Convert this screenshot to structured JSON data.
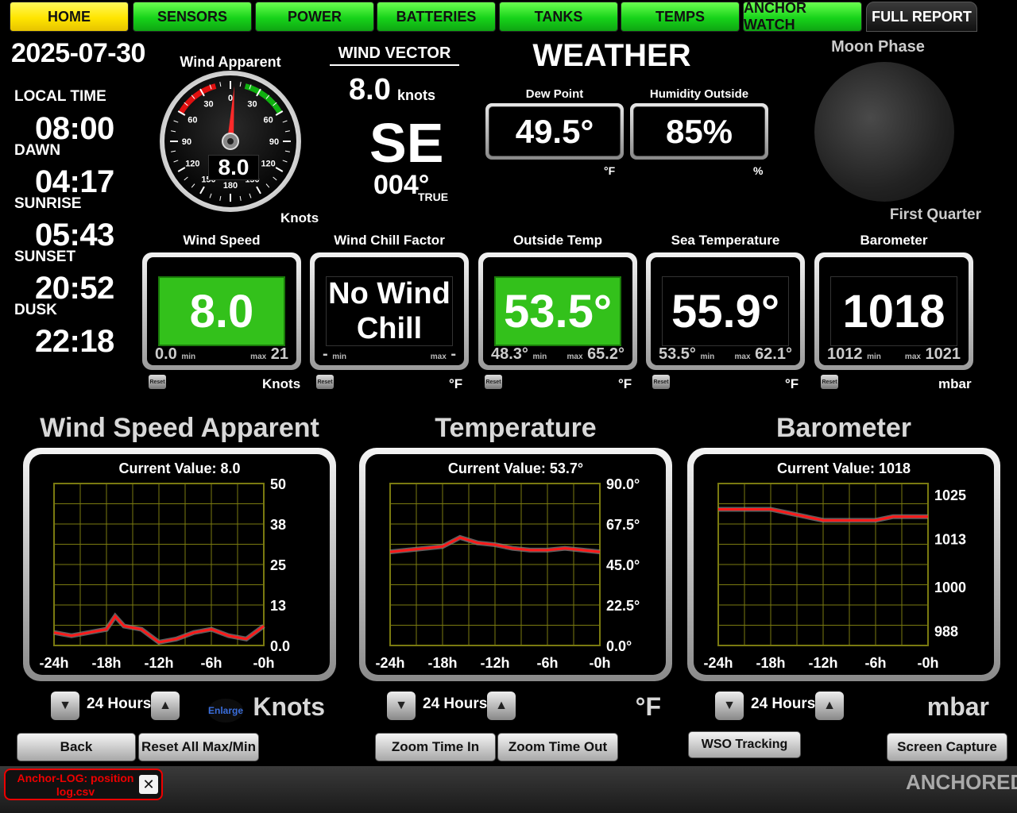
{
  "nav": {
    "tabs": [
      {
        "label": "HOME",
        "style": "yellow"
      },
      {
        "label": "SENSORS",
        "style": "green"
      },
      {
        "label": "POWER",
        "style": "green"
      },
      {
        "label": "BATTERIES",
        "style": "green"
      },
      {
        "label": "TANKS",
        "style": "green"
      },
      {
        "label": "TEMPS",
        "style": "green"
      },
      {
        "label": "ANCHOR WATCH",
        "style": "green"
      },
      {
        "label": "FULL REPORT",
        "style": "dark"
      }
    ]
  },
  "left": {
    "date": "2025-07-30",
    "local_time_label": "LOCAL TIME",
    "local_time": "08:00",
    "dawn_label": "DAWN",
    "dawn": "04:17",
    "sunrise_label": "SUNRISE",
    "sunrise": "05:43",
    "sunset_label": "SUNSET",
    "sunset": "20:52",
    "dusk_label": "DUSK",
    "dusk": "22:18"
  },
  "gauge": {
    "title": "Wind Apparent",
    "value": "8.0",
    "unit": "Knots",
    "ticks": [
      "0",
      "30",
      "60",
      "90",
      "120",
      "150",
      "180",
      "150",
      "120",
      "90",
      "60",
      "30"
    ],
    "needle_angle_deg": 4
  },
  "wind_vector": {
    "title": "WIND VECTOR",
    "speed": "8.0",
    "speed_unit": "knots",
    "direction": "SE",
    "bearing": "004°",
    "bearing_ref": "TRUE"
  },
  "weather": {
    "title": "WEATHER",
    "dew_point_label": "Dew Point",
    "dew_point": "49.5°",
    "dew_point_unit": "°F",
    "humidity_label": "Humidity Outside",
    "humidity": "85%",
    "humidity_unit": "%"
  },
  "moon": {
    "title": "Moon Phase",
    "phase": "First Quarter"
  },
  "tiles": [
    {
      "title": "Wind Speed",
      "value": "8.0",
      "min": "0.0",
      "max": "21",
      "unit": "Knots",
      "green": true,
      "small": false
    },
    {
      "title": "Wind Chill Factor",
      "value": "No Wind Chill",
      "min": "-",
      "max": "-",
      "unit": "°F",
      "green": false,
      "small": true
    },
    {
      "title": "Outside Temp",
      "value": "53.5°",
      "min": "48.3°",
      "max": "65.2°",
      "unit": "°F",
      "green": true,
      "small": false
    },
    {
      "title": "Sea Temperature",
      "value": "55.9°",
      "min": "53.5°",
      "max": "62.1°",
      "unit": "°F",
      "green": false,
      "small": false
    },
    {
      "title": "Barometer",
      "value": "1018",
      "min": "1012",
      "max": "1021",
      "unit": "mbar",
      "green": false,
      "small": false
    }
  ],
  "tile_labels": {
    "min": "min",
    "max": "max",
    "reset": "Reset"
  },
  "charts": {
    "hours_label": "24 Hours",
    "enlarge": "Enlarge",
    "panels": [
      {
        "title": "Wind Speed Apparent",
        "current": "Current Value: 8.0",
        "unit": "Knots",
        "yticks": [
          "50",
          "38",
          "25",
          "13",
          "0.0"
        ],
        "xticks": [
          "-24h",
          "-18h",
          "-12h",
          "-6h",
          "-0h"
        ]
      },
      {
        "title": "Temperature",
        "current": "Current Value: 53.7°",
        "unit": "°F",
        "yticks": [
          "90.0°",
          "67.5°",
          "45.0°",
          "22.5°",
          "0.0°"
        ],
        "xticks": [
          "-24h",
          "-18h",
          "-12h",
          "-6h",
          "-0h"
        ]
      },
      {
        "title": "Barometer",
        "current": "Current Value: 1018",
        "unit": "mbar",
        "yticks": [
          "1025",
          "1013",
          "1000",
          "988"
        ],
        "xticks": [
          "-24h",
          "-18h",
          "-12h",
          "-6h",
          "-0h"
        ]
      }
    ]
  },
  "chart_data": [
    {
      "type": "line",
      "title": "Wind Speed Apparent",
      "ylim": [
        0,
        50
      ],
      "x": [
        -24,
        -22,
        -20,
        -18,
        -17,
        -16,
        -14,
        -12,
        -10,
        -8,
        -6,
        -4,
        -2,
        0
      ],
      "series": [
        {
          "values": [
            4,
            3,
            4,
            5,
            9,
            6,
            5,
            1,
            2,
            4,
            5,
            3,
            2,
            6
          ]
        }
      ]
    },
    {
      "type": "line",
      "title": "Temperature",
      "ylim": [
        0,
        90
      ],
      "x": [
        -24,
        -22,
        -20,
        -18,
        -16,
        -14,
        -12,
        -10,
        -8,
        -6,
        -4,
        -2,
        0
      ],
      "series": [
        {
          "values": [
            52,
            53,
            54,
            55,
            60,
            57,
            56,
            54,
            53,
            53,
            54,
            53,
            52
          ]
        }
      ]
    },
    {
      "type": "line",
      "title": "Barometer",
      "ylim": [
        984,
        1028
      ],
      "x": [
        -24,
        -20,
        -18,
        -16,
        -14,
        -12,
        -10,
        -8,
        -6,
        -4,
        -2,
        0
      ],
      "series": [
        {
          "values": [
            1021,
            1021,
            1021,
            1020,
            1019,
            1018,
            1018,
            1018,
            1018,
            1019,
            1019,
            1019
          ]
        }
      ]
    }
  ],
  "buttons": {
    "back": "Back",
    "reset_all": "Reset All Max/Min",
    "zoom_in": "Zoom Time In",
    "zoom_out": "Zoom Time Out",
    "wso": "WSO Tracking",
    "capture": "Screen Capture"
  },
  "status": {
    "notice": "Anchor-LOG: position log.csv",
    "state": "ANCHORED"
  },
  "colors": {
    "accent_green": "#33c11b",
    "tab_yellow": "#ffe500",
    "series_red": "#ff1a1a",
    "series_gray": "#888888",
    "grid": "#7a7a10"
  }
}
